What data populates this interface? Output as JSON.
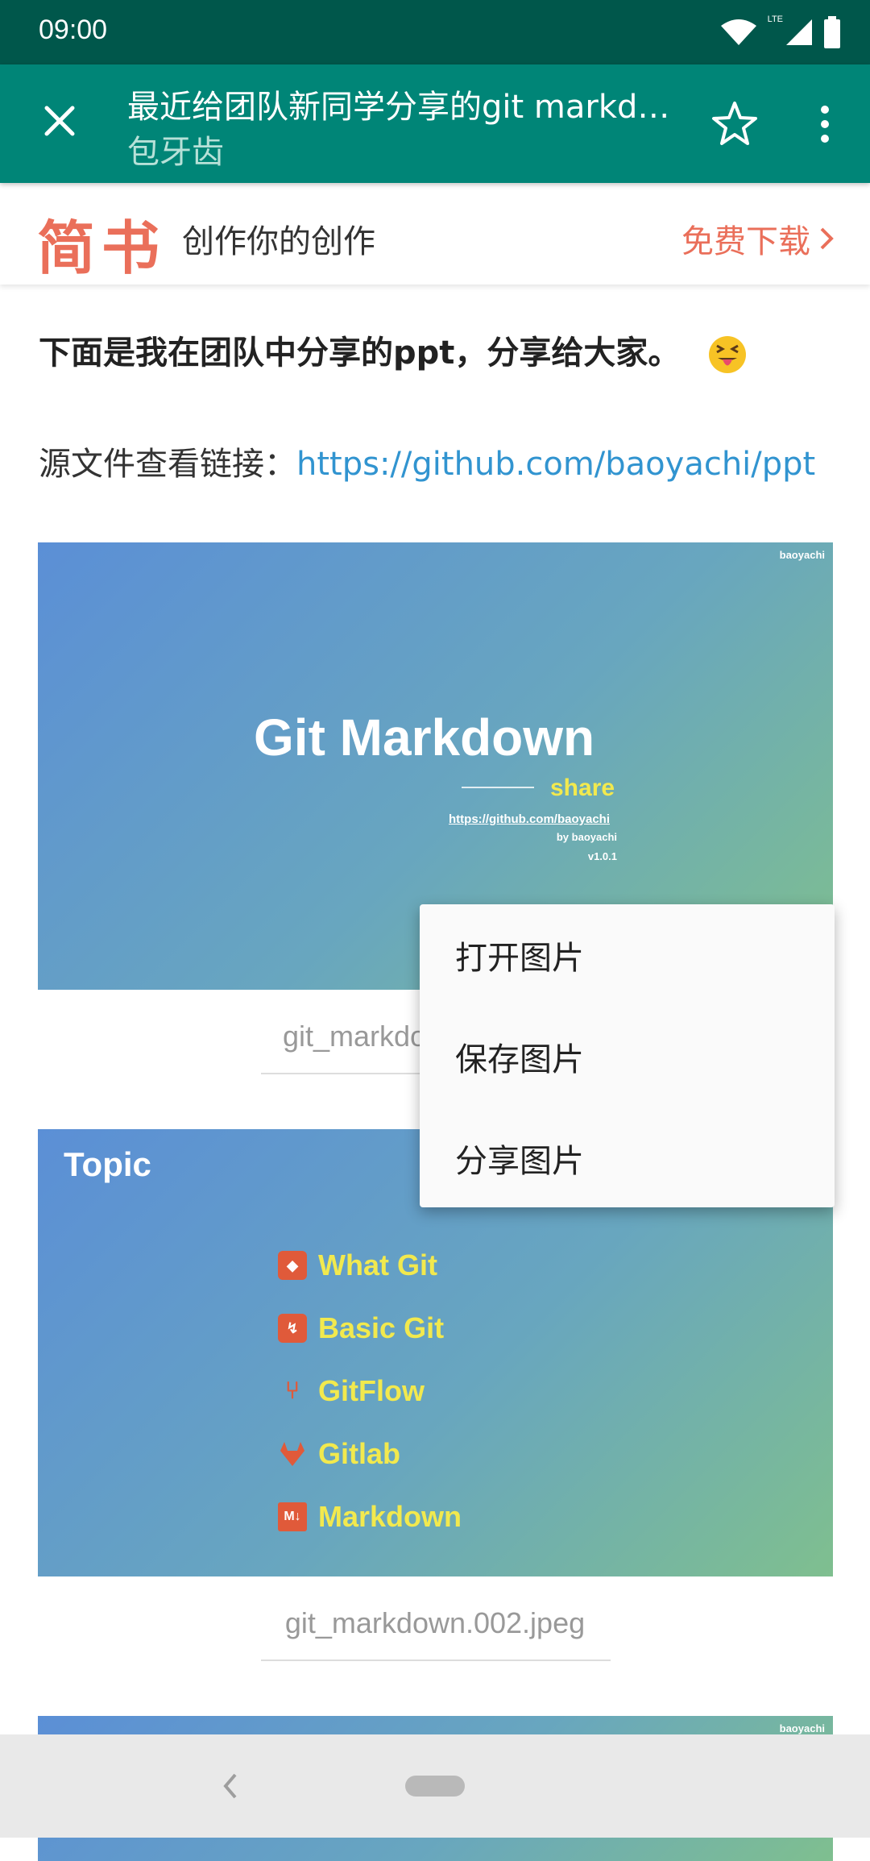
{
  "status_bar": {
    "time": "09:00",
    "network": "LTE"
  },
  "toolbar": {
    "title": "最近给团队新同学分享的git markd…",
    "subtitle": "包牙齿"
  },
  "jianshu_bar": {
    "logo": "简书",
    "slogan": "创作你的创作",
    "download": "免费下载"
  },
  "article": {
    "intro": "下面是我在团队中分享的ppt，分享给大家。",
    "source_label": "源文件查看链接：",
    "source_link": "https://github.com/baoyachi/ppt",
    "slide1": {
      "brand": "baoyachi",
      "title": "Git Markdown",
      "tag": "share",
      "url": "https://github.com/baoyachi",
      "by": "by baoyachi",
      "version": "v1.0.1"
    },
    "caption1": "git_markdo",
    "slide2": {
      "heading": "Topic",
      "items": [
        "What Git",
        "Basic Git",
        "GitFlow",
        "Gitlab",
        "Markdown"
      ]
    },
    "caption2": "git_markdown.002.jpeg",
    "slide3": {
      "brand": "baoyachi"
    }
  },
  "context_menu": {
    "items": [
      "打开图片",
      "保存图片",
      "分享图片"
    ]
  },
  "colors": {
    "status_bar": "#00574b",
    "toolbar": "#008577",
    "jianshu_accent": "#ea6f5a",
    "link": "#3194d0"
  }
}
